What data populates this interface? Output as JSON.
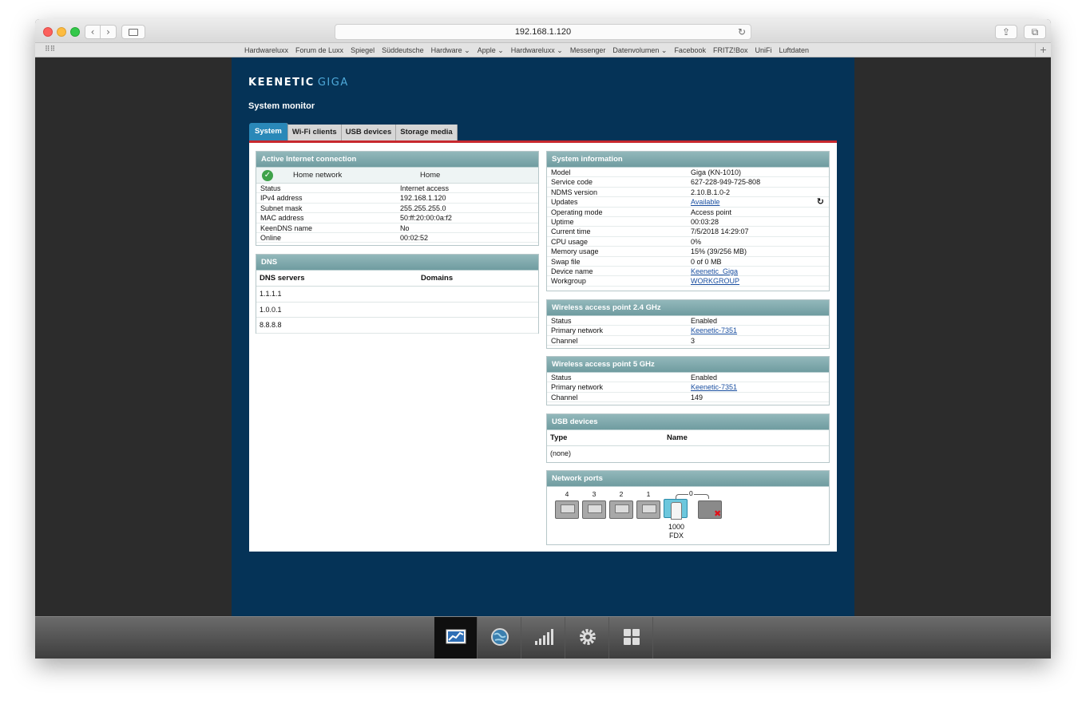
{
  "browser": {
    "url": "192.168.1.120",
    "favorites": [
      "Hardwareluxx",
      "Forum de Luxx",
      "Spiegel",
      "Süddeutsche",
      "Hardware ⌄",
      "Apple ⌄",
      "Hardwareluxx ⌄",
      "Messenger",
      "Datenvolumen ⌄",
      "Facebook",
      "FRITZ!Box",
      "UniFi",
      "Luftdaten"
    ]
  },
  "brand": {
    "name": "KEENETIC",
    "model": "GIGA"
  },
  "page_title": "System monitor",
  "tabs": [
    "System",
    "Wi-Fi clients",
    "USB devices",
    "Storage media"
  ],
  "active_connection": {
    "title": "Active Internet connection",
    "network_name": "Home network",
    "network_type": "Home",
    "rows": [
      {
        "k": "Status",
        "v": "Internet access"
      },
      {
        "k": "IPv4 address",
        "v": "192.168.1.120"
      },
      {
        "k": "Subnet mask",
        "v": "255.255.255.0"
      },
      {
        "k": "MAC address",
        "v": "50:ff:20:00:0a:f2"
      },
      {
        "k": "KeenDNS name",
        "v": "No"
      },
      {
        "k": "Online",
        "v": "00:02:52"
      }
    ]
  },
  "dns": {
    "title": "DNS",
    "col_servers": "DNS servers",
    "col_domains": "Domains",
    "servers": [
      "1.1.1.1",
      "1.0.0.1",
      "8.8.8.8"
    ]
  },
  "system_info": {
    "title": "System information",
    "rows": [
      {
        "k": "Model",
        "v": "Giga (KN-1010)"
      },
      {
        "k": "Service code",
        "v": "627-228-949-725-808"
      },
      {
        "k": "NDMS version",
        "v": "2.10.B.1.0-2"
      },
      {
        "k": "Updates",
        "v": "Available",
        "link": true
      },
      {
        "k": "Operating mode",
        "v": "Access point"
      },
      {
        "k": "Uptime",
        "v": "00:03:28"
      },
      {
        "k": "Current time",
        "v": "7/5/2018 14:29:07"
      },
      {
        "k": "CPU usage",
        "v": "0%"
      },
      {
        "k": "Memory usage",
        "v": "15% (39/256 MB)"
      },
      {
        "k": "Swap file",
        "v": "0 of 0 MB"
      },
      {
        "k": "Device name",
        "v": "Keenetic_Giga",
        "link": true
      },
      {
        "k": "Workgroup",
        "v": "WORKGROUP",
        "link": true
      }
    ]
  },
  "wap24": {
    "title": "Wireless access point 2.4 GHz",
    "rows": [
      {
        "k": "Status",
        "v": "Enabled"
      },
      {
        "k": "Primary network",
        "v": "Keenetic-7351",
        "link": true
      },
      {
        "k": "Channel",
        "v": "3"
      }
    ]
  },
  "wap5": {
    "title": "Wireless access point 5 GHz",
    "rows": [
      {
        "k": "Status",
        "v": "Enabled"
      },
      {
        "k": "Primary network",
        "v": "Keenetic-7351",
        "link": true
      },
      {
        "k": "Channel",
        "v": "149"
      }
    ]
  },
  "usb": {
    "title": "USB devices",
    "col_type": "Type",
    "col_name": "Name",
    "value": "(none)"
  },
  "network_ports": {
    "title": "Network ports",
    "ports": [
      "4",
      "3",
      "2",
      "1"
    ],
    "wan_label": "0",
    "speed_line1": "1000",
    "speed_line2": "FDX"
  },
  "bottom_nav": [
    "monitor-icon",
    "globe-icon",
    "signal-bars-icon",
    "gear-icon",
    "apps-grid-icon"
  ]
}
